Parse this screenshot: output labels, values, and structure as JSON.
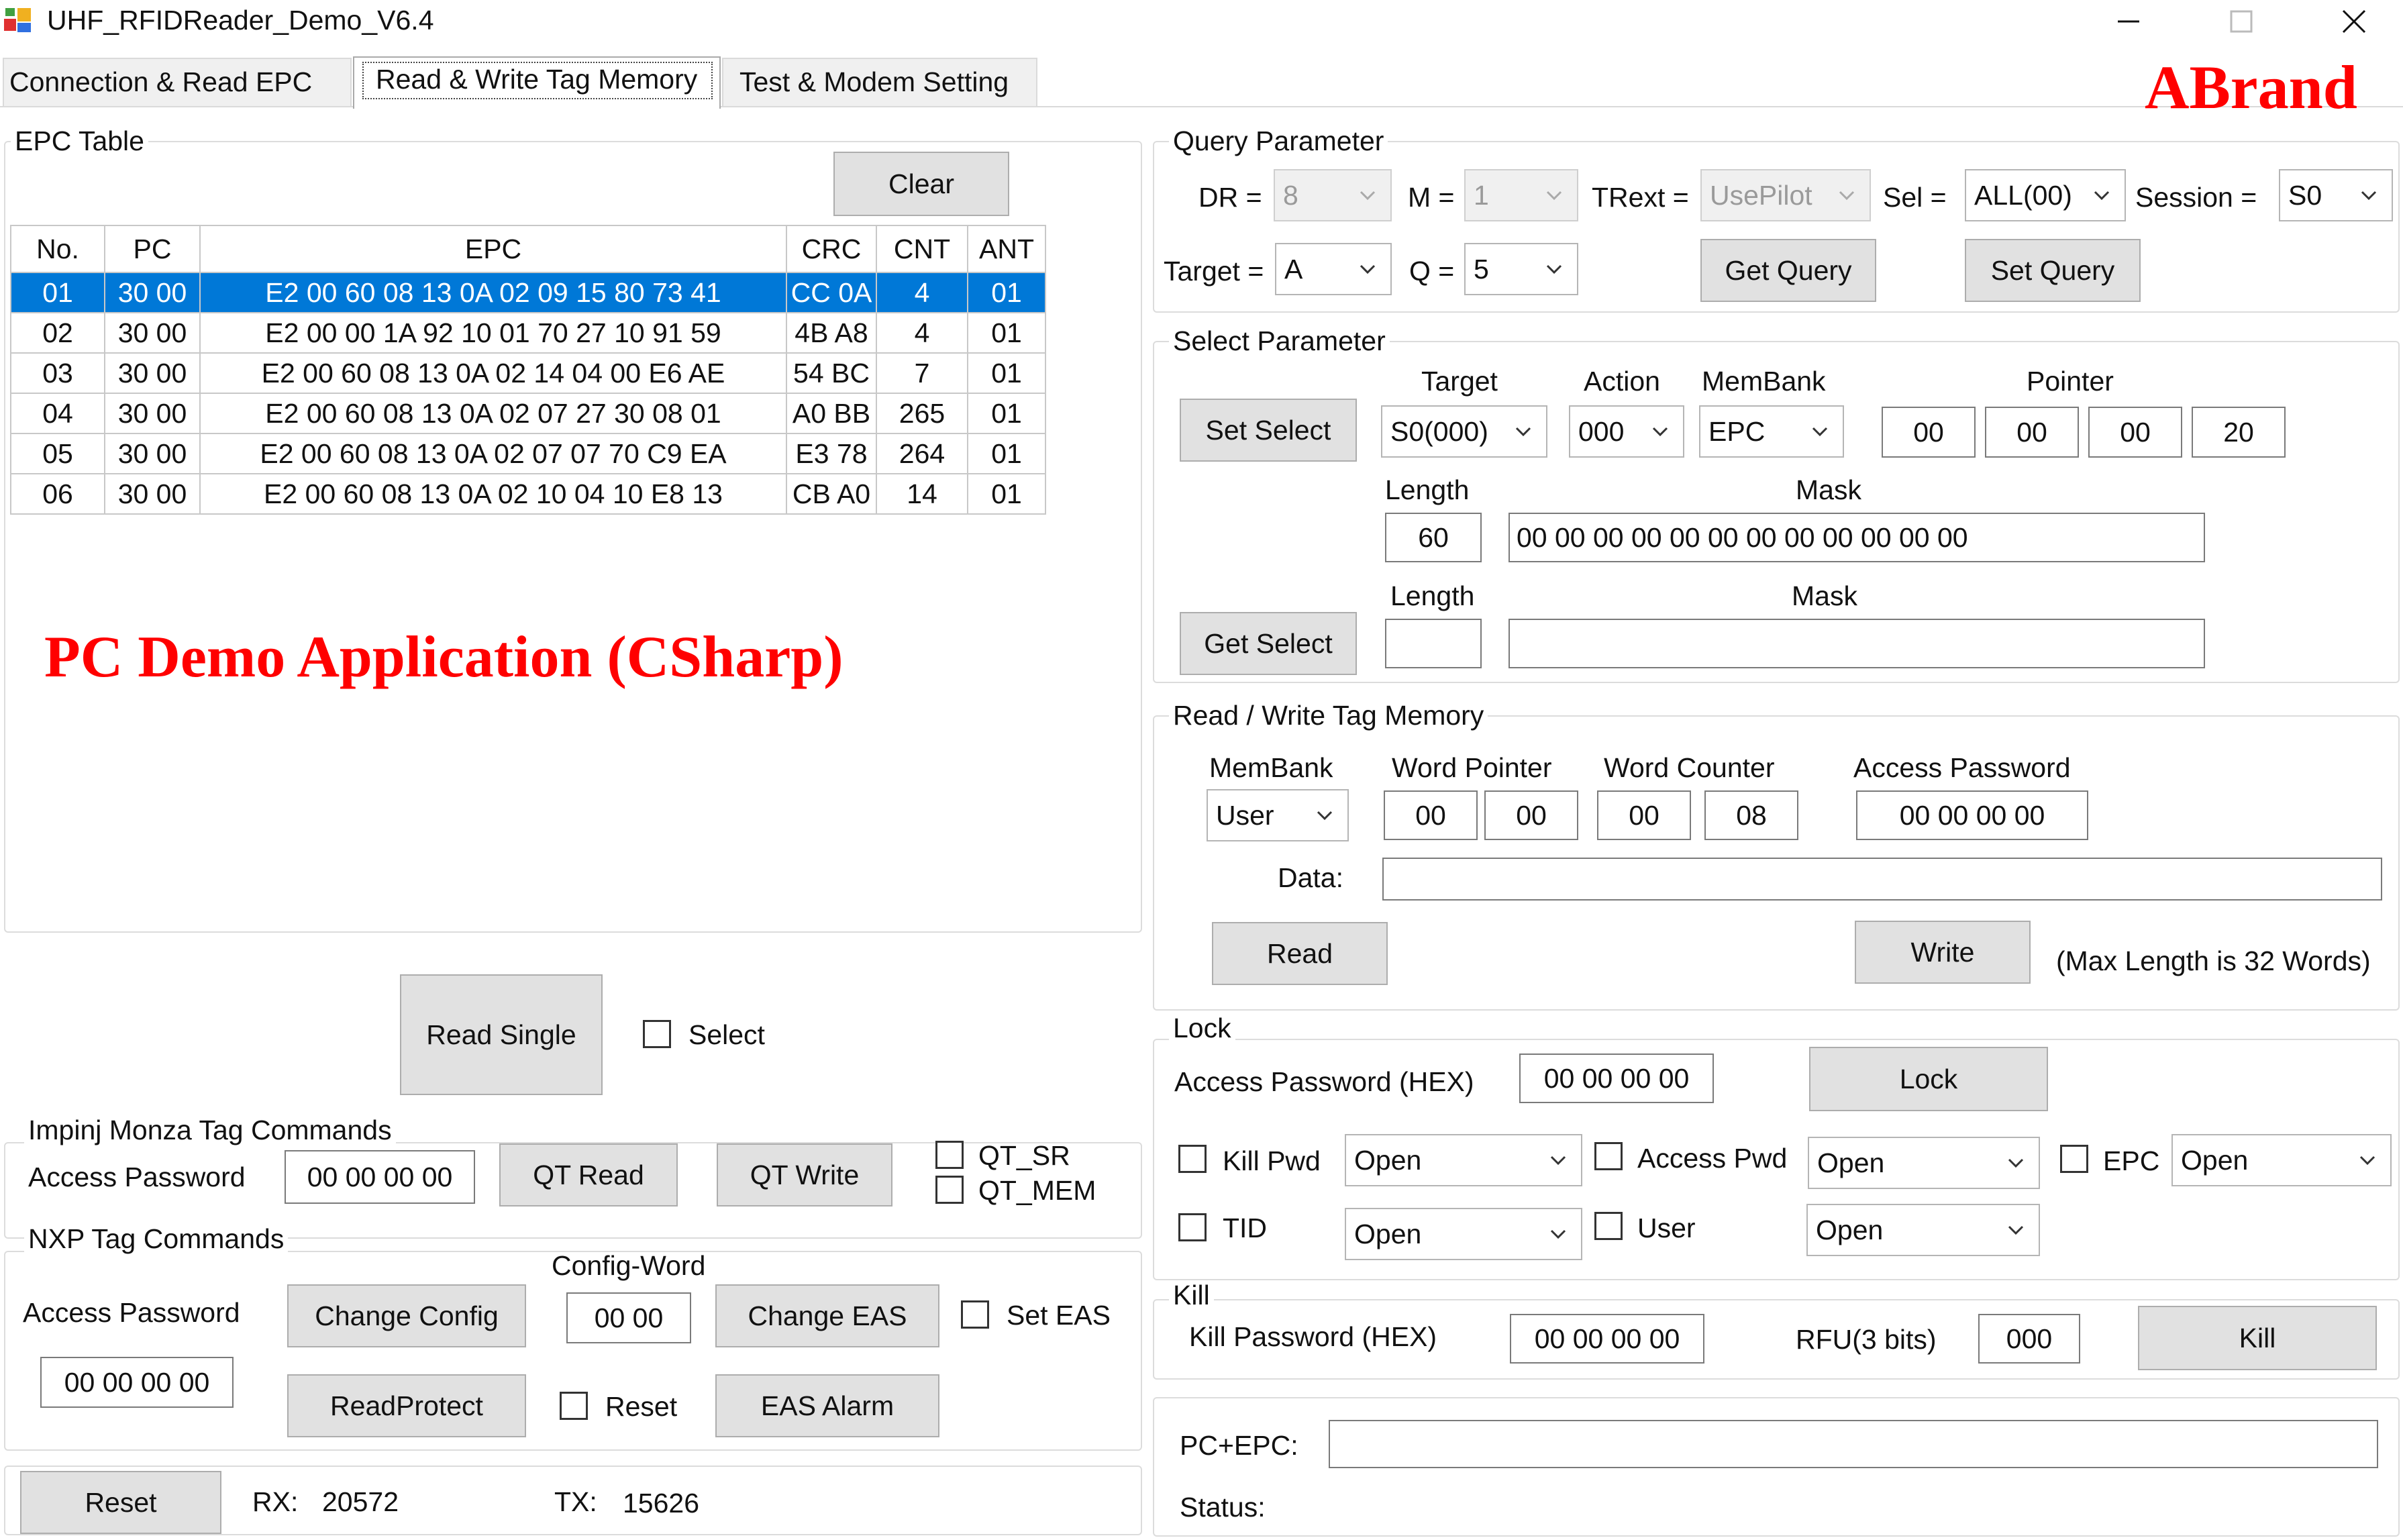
{
  "window": {
    "title": "UHF_RFIDReader_Demo_V6.4"
  },
  "tabs": [
    {
      "label": "Connection & Read EPC"
    },
    {
      "label": "Read & Write Tag Memory"
    },
    {
      "label": "Test & Modem Setting"
    }
  ],
  "overlay": {
    "brand": "ABrand",
    "caption": "PC Demo Application (CSharp)"
  },
  "epc_table": {
    "title": "EPC Table",
    "clear_label": "Clear",
    "headers": [
      "No.",
      "PC",
      "EPC",
      "CRC",
      "CNT",
      "ANT"
    ],
    "rows": [
      [
        "01",
        "30 00",
        "E2 00 60 08 13 0A 02 09 15 80 73 41",
        "CC 0A",
        "4",
        "01"
      ],
      [
        "02",
        "30 00",
        "E2 00 00 1A 92 10 01 70 27 10 91 59",
        "4B A8",
        "4",
        "01"
      ],
      [
        "03",
        "30 00",
        "E2 00 60 08 13 0A 02 14 04 00 E6 AE",
        "54 BC",
        "7",
        "01"
      ],
      [
        "04",
        "30 00",
        "E2 00 60 08 13 0A 02 07 27 30 08 01",
        "A0 BB",
        "265",
        "01"
      ],
      [
        "05",
        "30 00",
        "E2 00 60 08 13 0A 02 07 07 70 C9 EA",
        "E3 78",
        "264",
        "01"
      ],
      [
        "06",
        "30 00",
        "E2 00 60 08 13 0A 02 10 04 10 E8 13",
        "CB A0",
        "14",
        "01"
      ]
    ]
  },
  "read_single": {
    "button": "Read Single",
    "select_label": "Select"
  },
  "impinj": {
    "title": "Impinj Monza Tag Commands",
    "access_label": "Access Password",
    "access_value": "00 00 00 00",
    "qt_read": "QT Read",
    "qt_write": "QT Write",
    "qt_sr": "QT_SR",
    "qt_mem": "QT_MEM"
  },
  "nxp": {
    "title": "NXP Tag Commands",
    "access_label": "Access Password",
    "access_value": "00 00 00 00",
    "change_config": "Change Config",
    "config_word_label": "Config-Word",
    "config_word_value": "00 00",
    "change_eas": "Change EAS",
    "set_eas": "Set EAS",
    "read_protect": "ReadProtect",
    "reset_check": "Reset",
    "eas_alarm": "EAS Alarm"
  },
  "bottom": {
    "reset": "Reset",
    "rx_label": "RX:",
    "rx_value": "20572",
    "tx_label": "TX:",
    "tx_value": "15626"
  },
  "query": {
    "title": "Query Parameter",
    "dr_label": "DR =",
    "dr_value": "8",
    "m_label": "M =",
    "m_value": "1",
    "trext_label": "TRext =",
    "trext_value": "UsePilot",
    "sel_label": "Sel =",
    "sel_value": "ALL(00)",
    "session_label": "Session =",
    "session_value": "S0",
    "target_label": "Target =",
    "target_value": "A",
    "q_label": "Q =",
    "q_value": "5",
    "get_query": "Get Query",
    "set_query": "Set Query"
  },
  "select_param": {
    "title": "Select Parameter",
    "target_label": "Target",
    "action_label": "Action",
    "membank_label": "MemBank",
    "pointer_label": "Pointer",
    "set_select": "Set Select",
    "target_value": "S0(000)",
    "action_value": "000",
    "membank_value": "EPC",
    "pointer_values": [
      "00",
      "00",
      "00",
      "20"
    ],
    "length_label": "Length",
    "mask_label": "Mask",
    "length_value": "60",
    "mask_value": "00 00 00 00 00 00 00 00 00 00 00 00",
    "get_select": "Get Select",
    "length_label2": "Length",
    "mask_label2": "Mask"
  },
  "rw": {
    "title": "Read / Write Tag Memory",
    "membank_label": "MemBank",
    "membank_value": "User",
    "word_pointer_label": "Word Pointer",
    "wp_values": [
      "00",
      "00"
    ],
    "word_counter_label": "Word Counter",
    "wc_values": [
      "00",
      "08"
    ],
    "access_label": "Access Password",
    "access_value": "00 00 00 00",
    "data_label": "Data:",
    "read": "Read",
    "write": "Write",
    "max_note": "(Max Length is 32 Words)"
  },
  "lock": {
    "title": "Lock",
    "access_label": "Access Password (HEX)",
    "access_value": "00 00 00 00",
    "lock_button": "Lock",
    "kill_pwd_label": "Kill Pwd",
    "kill_pwd_value": "Open",
    "access_pwd_label": "Access Pwd",
    "access_pwd_value": "Open",
    "epc_label": "EPC",
    "epc_value": "Open",
    "tid_label": "TID",
    "tid_value": "Open",
    "user_label": "User",
    "user_value": "Open"
  },
  "kill": {
    "title": "Kill",
    "pwd_label": "Kill Password (HEX)",
    "pwd_value": "00 00 00 00",
    "rfu_label": "RFU(3 bits)",
    "rfu_value": "000",
    "kill_button": "Kill"
  },
  "footer": {
    "pc_epc_label": "PC+EPC:",
    "status_label": "Status:"
  },
  "colors": {
    "selection": "#0078d7",
    "brand_red": "#ff0000",
    "button_face": "#e1e1e1"
  }
}
